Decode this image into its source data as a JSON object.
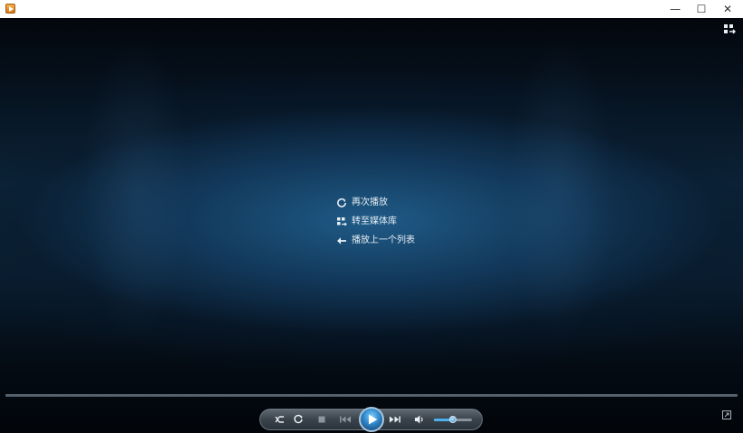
{
  "titlebar": {
    "title": "",
    "minimize_glyph": "—",
    "maximize_glyph": "☐",
    "close_glyph": "✕"
  },
  "menu": {
    "items": [
      {
        "label": "再次播放",
        "icon": "replay-icon"
      },
      {
        "label": "转至媒体库",
        "icon": "library-icon"
      },
      {
        "label": "播放上一个列表",
        "icon": "back-arrow-icon"
      }
    ]
  },
  "controls": {
    "volume_level": 0.5,
    "buttons": [
      "shuffle-icon",
      "repeat-icon",
      "stop-icon",
      "previous-icon",
      "play-icon",
      "next-icon",
      "volume-icon"
    ]
  },
  "colors": {
    "accent": "#2f86c9",
    "menu_text": "#e8eef4",
    "control_bar": "#3a434c"
  }
}
